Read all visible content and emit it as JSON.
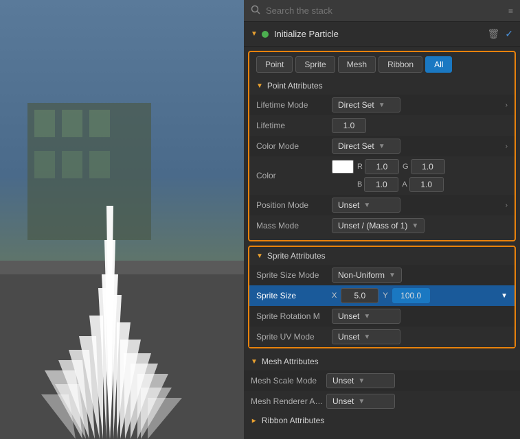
{
  "search": {
    "placeholder": "Search the stack"
  },
  "header": {
    "title": "Initialize Particle",
    "trash_label": "🗑",
    "check_label": "✓"
  },
  "tabs": [
    {
      "label": "Point",
      "active": false
    },
    {
      "label": "Sprite",
      "active": false
    },
    {
      "label": "Mesh",
      "active": false
    },
    {
      "label": "Ribbon",
      "active": false
    },
    {
      "label": "All",
      "active": true
    }
  ],
  "point_attributes": {
    "section_title": "Point Attributes",
    "props": [
      {
        "label": "Lifetime Mode",
        "value": "Direct Set",
        "type": "dropdown"
      },
      {
        "label": "Lifetime",
        "value": "1.0",
        "type": "number"
      },
      {
        "label": "Color Mode",
        "value": "Direct Set",
        "type": "dropdown"
      },
      {
        "label": "Color",
        "r": "1.0",
        "g": "1.0",
        "b": "1.0",
        "a": "1.0",
        "type": "color"
      },
      {
        "label": "Position Mode",
        "value": "Unset",
        "type": "dropdown"
      },
      {
        "label": "Mass Mode",
        "value": "Unset / (Mass of 1)",
        "type": "dropdown"
      }
    ]
  },
  "sprite_attributes": {
    "section_title": "Sprite Attributes",
    "props": [
      {
        "label": "Sprite Size Mode",
        "value": "Non-Uniform",
        "type": "dropdown",
        "highlighted": false
      },
      {
        "label": "Sprite Size",
        "x": "5.0",
        "y": "100.0",
        "type": "xy",
        "highlighted": true
      },
      {
        "label": "Sprite Rotation M",
        "value": "Unset",
        "type": "dropdown"
      },
      {
        "label": "Sprite UV Mode",
        "value": "Unset",
        "type": "dropdown"
      }
    ]
  },
  "mesh_attributes": {
    "section_title": "Mesh Attributes",
    "props": [
      {
        "label": "Mesh Scale Mode",
        "value": "Unset",
        "type": "dropdown"
      },
      {
        "label": "Mesh Renderer A…",
        "value": "Unset",
        "type": "dropdown"
      }
    ]
  },
  "ribbon_attributes": {
    "section_title": "Ribbon Attributes"
  },
  "colors": {
    "orange": "#e8820c",
    "blue_active": "#1a78c2",
    "green": "#4caf50"
  }
}
